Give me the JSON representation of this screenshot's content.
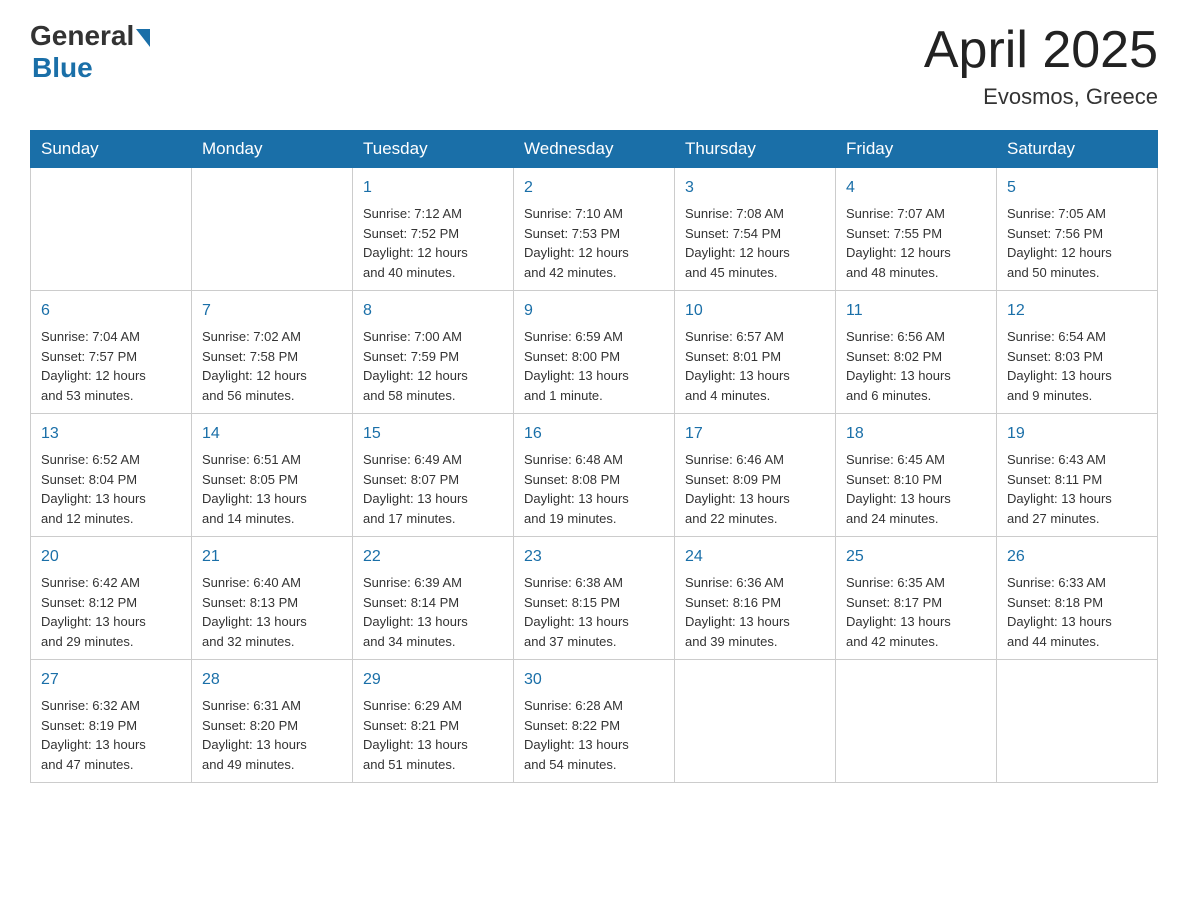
{
  "header": {
    "logo_general": "General",
    "logo_blue": "Blue",
    "month_title": "April 2025",
    "location": "Evosmos, Greece"
  },
  "weekdays": [
    "Sunday",
    "Monday",
    "Tuesday",
    "Wednesday",
    "Thursday",
    "Friday",
    "Saturday"
  ],
  "weeks": [
    [
      {
        "day": "",
        "info": ""
      },
      {
        "day": "",
        "info": ""
      },
      {
        "day": "1",
        "info": "Sunrise: 7:12 AM\nSunset: 7:52 PM\nDaylight: 12 hours\nand 40 minutes."
      },
      {
        "day": "2",
        "info": "Sunrise: 7:10 AM\nSunset: 7:53 PM\nDaylight: 12 hours\nand 42 minutes."
      },
      {
        "day": "3",
        "info": "Sunrise: 7:08 AM\nSunset: 7:54 PM\nDaylight: 12 hours\nand 45 minutes."
      },
      {
        "day": "4",
        "info": "Sunrise: 7:07 AM\nSunset: 7:55 PM\nDaylight: 12 hours\nand 48 minutes."
      },
      {
        "day": "5",
        "info": "Sunrise: 7:05 AM\nSunset: 7:56 PM\nDaylight: 12 hours\nand 50 minutes."
      }
    ],
    [
      {
        "day": "6",
        "info": "Sunrise: 7:04 AM\nSunset: 7:57 PM\nDaylight: 12 hours\nand 53 minutes."
      },
      {
        "day": "7",
        "info": "Sunrise: 7:02 AM\nSunset: 7:58 PM\nDaylight: 12 hours\nand 56 minutes."
      },
      {
        "day": "8",
        "info": "Sunrise: 7:00 AM\nSunset: 7:59 PM\nDaylight: 12 hours\nand 58 minutes."
      },
      {
        "day": "9",
        "info": "Sunrise: 6:59 AM\nSunset: 8:00 PM\nDaylight: 13 hours\nand 1 minute."
      },
      {
        "day": "10",
        "info": "Sunrise: 6:57 AM\nSunset: 8:01 PM\nDaylight: 13 hours\nand 4 minutes."
      },
      {
        "day": "11",
        "info": "Sunrise: 6:56 AM\nSunset: 8:02 PM\nDaylight: 13 hours\nand 6 minutes."
      },
      {
        "day": "12",
        "info": "Sunrise: 6:54 AM\nSunset: 8:03 PM\nDaylight: 13 hours\nand 9 minutes."
      }
    ],
    [
      {
        "day": "13",
        "info": "Sunrise: 6:52 AM\nSunset: 8:04 PM\nDaylight: 13 hours\nand 12 minutes."
      },
      {
        "day": "14",
        "info": "Sunrise: 6:51 AM\nSunset: 8:05 PM\nDaylight: 13 hours\nand 14 minutes."
      },
      {
        "day": "15",
        "info": "Sunrise: 6:49 AM\nSunset: 8:07 PM\nDaylight: 13 hours\nand 17 minutes."
      },
      {
        "day": "16",
        "info": "Sunrise: 6:48 AM\nSunset: 8:08 PM\nDaylight: 13 hours\nand 19 minutes."
      },
      {
        "day": "17",
        "info": "Sunrise: 6:46 AM\nSunset: 8:09 PM\nDaylight: 13 hours\nand 22 minutes."
      },
      {
        "day": "18",
        "info": "Sunrise: 6:45 AM\nSunset: 8:10 PM\nDaylight: 13 hours\nand 24 minutes."
      },
      {
        "day": "19",
        "info": "Sunrise: 6:43 AM\nSunset: 8:11 PM\nDaylight: 13 hours\nand 27 minutes."
      }
    ],
    [
      {
        "day": "20",
        "info": "Sunrise: 6:42 AM\nSunset: 8:12 PM\nDaylight: 13 hours\nand 29 minutes."
      },
      {
        "day": "21",
        "info": "Sunrise: 6:40 AM\nSunset: 8:13 PM\nDaylight: 13 hours\nand 32 minutes."
      },
      {
        "day": "22",
        "info": "Sunrise: 6:39 AM\nSunset: 8:14 PM\nDaylight: 13 hours\nand 34 minutes."
      },
      {
        "day": "23",
        "info": "Sunrise: 6:38 AM\nSunset: 8:15 PM\nDaylight: 13 hours\nand 37 minutes."
      },
      {
        "day": "24",
        "info": "Sunrise: 6:36 AM\nSunset: 8:16 PM\nDaylight: 13 hours\nand 39 minutes."
      },
      {
        "day": "25",
        "info": "Sunrise: 6:35 AM\nSunset: 8:17 PM\nDaylight: 13 hours\nand 42 minutes."
      },
      {
        "day": "26",
        "info": "Sunrise: 6:33 AM\nSunset: 8:18 PM\nDaylight: 13 hours\nand 44 minutes."
      }
    ],
    [
      {
        "day": "27",
        "info": "Sunrise: 6:32 AM\nSunset: 8:19 PM\nDaylight: 13 hours\nand 47 minutes."
      },
      {
        "day": "28",
        "info": "Sunrise: 6:31 AM\nSunset: 8:20 PM\nDaylight: 13 hours\nand 49 minutes."
      },
      {
        "day": "29",
        "info": "Sunrise: 6:29 AM\nSunset: 8:21 PM\nDaylight: 13 hours\nand 51 minutes."
      },
      {
        "day": "30",
        "info": "Sunrise: 6:28 AM\nSunset: 8:22 PM\nDaylight: 13 hours\nand 54 minutes."
      },
      {
        "day": "",
        "info": ""
      },
      {
        "day": "",
        "info": ""
      },
      {
        "day": "",
        "info": ""
      }
    ]
  ]
}
